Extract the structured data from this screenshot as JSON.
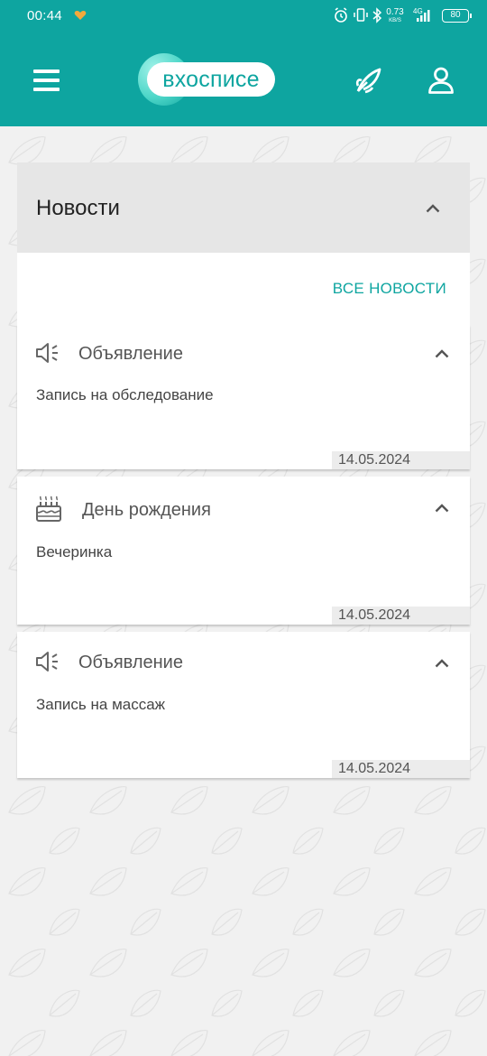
{
  "status_bar": {
    "time": "00:44",
    "net_speed_value": "0.73",
    "net_speed_unit": "KB/S",
    "network": "4G",
    "battery": "80"
  },
  "app_bar": {
    "logo_text": "вхосписе",
    "brand_color": "#0ea5a0"
  },
  "news": {
    "title": "Новости",
    "all_news_label": "ВСЕ НОВОСТИ",
    "items": [
      {
        "icon": "megaphone-icon",
        "category": "Объявление",
        "text": "Запись на обследование",
        "date": "14.05.2024"
      },
      {
        "icon": "birthday-cake-icon",
        "category": "День рождения",
        "text": "Вечеринка",
        "date": "14.05.2024"
      },
      {
        "icon": "megaphone-icon",
        "category": "Объявление",
        "text": "Запись на массаж",
        "date": "14.05.2024"
      }
    ]
  }
}
